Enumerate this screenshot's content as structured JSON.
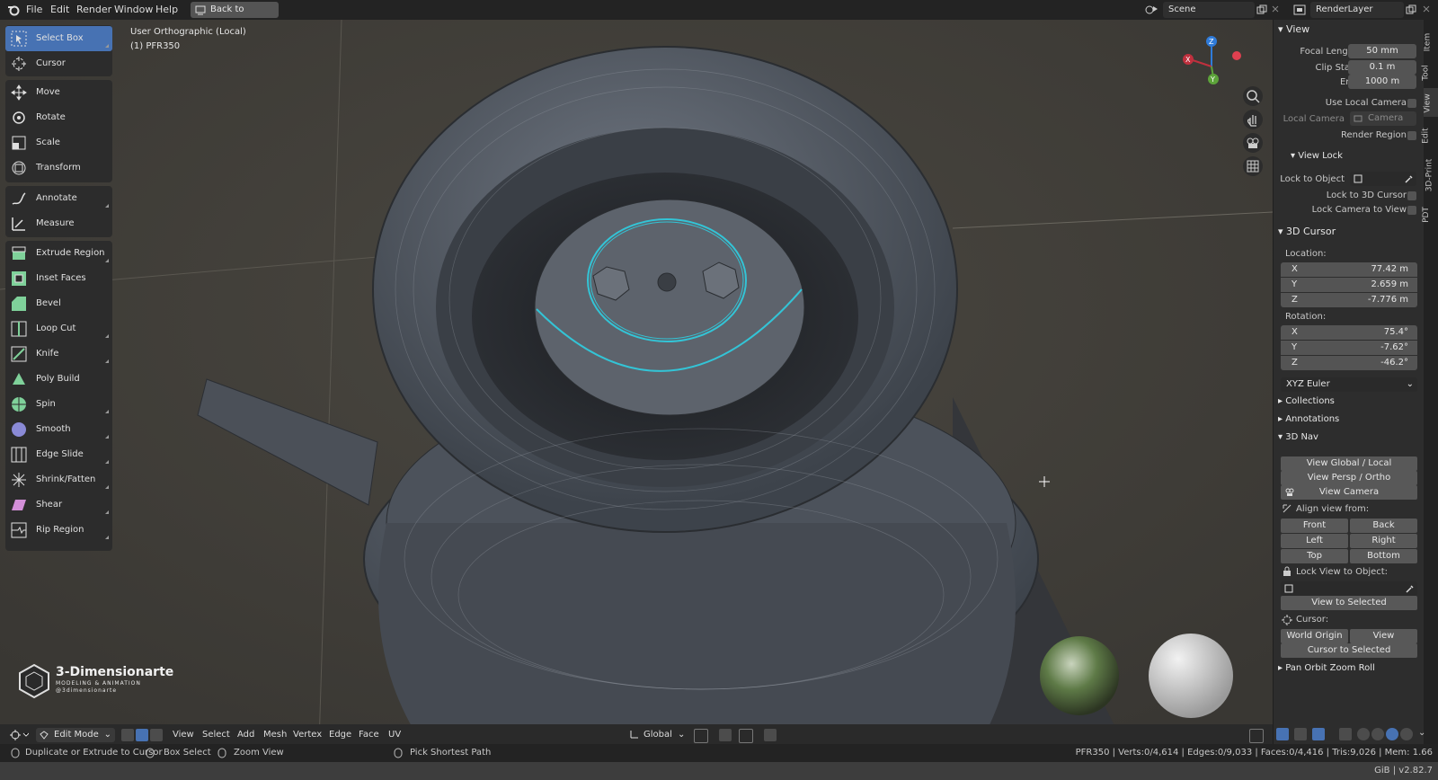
{
  "topbar": {
    "menus": [
      "File",
      "Edit",
      "Render",
      "Window",
      "Help"
    ],
    "back_label": "Back to Previous",
    "scene": "Scene",
    "render_layer": "RenderLayer"
  },
  "viewport": {
    "view_name": "User Orthographic (Local)",
    "object_name": "(1) PFR350",
    "logo_title": "3-Dimensionarte",
    "logo_sub": "MODELING & ANIMATION",
    "logo_sub2": "@3dimensionarte",
    "gizmo": {
      "x": "X",
      "y": "Y",
      "z": "Z"
    }
  },
  "tools": [
    "Select Box",
    "Cursor",
    "Move",
    "Rotate",
    "Scale",
    "Transform",
    "Annotate",
    "Measure",
    "Extrude Region",
    "Inset Faces",
    "Bevel",
    "Loop Cut",
    "Knife",
    "Poly Build",
    "Spin",
    "Smooth",
    "Edge Slide",
    "Shrink/Fatten",
    "Shear",
    "Rip Region"
  ],
  "sidebar": {
    "tabs": [
      "Item",
      "Tool",
      "View",
      "Edit",
      "3D-Print",
      "PDT"
    ],
    "view": {
      "title": "View",
      "focal_length_label": "Focal Length",
      "focal_length": "50 mm",
      "clip_start_label": "Clip Start",
      "clip_start": "0.1 m",
      "end_label": "End",
      "end": "1000 m",
      "use_local_camera": "Use Local Camera",
      "local_camera_label": "Local Camera",
      "local_camera": "Camera",
      "render_region": "Render Region"
    },
    "view_lock": {
      "title": "View Lock",
      "lock_to_object": "Lock to Object",
      "lock_to_cursor": "Lock to 3D Cursor",
      "lock_camera": "Lock Camera to View"
    },
    "cursor": {
      "title": "3D Cursor",
      "location_label": "Location:",
      "loc": [
        {
          "axis": "X",
          "value": "77.42 m"
        },
        {
          "axis": "Y",
          "value": "2.659 m"
        },
        {
          "axis": "Z",
          "value": "-7.776 m"
        }
      ],
      "rotation_label": "Rotation:",
      "rot": [
        {
          "axis": "X",
          "value": "75.4°"
        },
        {
          "axis": "Y",
          "value": "-7.62°"
        },
        {
          "axis": "Z",
          "value": "-46.2°"
        }
      ],
      "rotation_mode": "XYZ Euler"
    },
    "collections": "Collections",
    "annotations": "Annotations",
    "nav": {
      "title": "3D Nav",
      "view_global_local": "View Global / Local",
      "view_persp_ortho": "View Persp / Ortho",
      "view_camera": "View Camera",
      "align_label": "Align view from:",
      "front": "Front",
      "back": "Back",
      "left": "Left",
      "right": "Right",
      "top": "Top",
      "bottom": "Bottom",
      "lock_view_label": "Lock View to Object:",
      "view_to_selected": "View to Selected",
      "cursor_label": "Cursor:",
      "world_origin": "World Origin",
      "view": "View",
      "cursor_to_selected": "Cursor to Selected",
      "pan_orbit": "Pan Orbit Zoom Roll"
    }
  },
  "bottombar": {
    "mode": "Edit Mode",
    "menus": [
      "View",
      "Select",
      "Add",
      "Mesh",
      "Vertex",
      "Edge",
      "Face",
      "UV"
    ],
    "orientation": "Global"
  },
  "status": {
    "hint1": "Duplicate or Extrude to Cursor",
    "hint2": "Box Select",
    "hint3": "Zoom View",
    "hint4": "Pick Shortest Path",
    "stats": "PFR350 | Verts:0/4,614 | Edges:0/9,033 | Faces:0/4,416 | Tris:9,026 | Mem: 1.66 GiB | v2.82.7"
  },
  "colors": {
    "accent": "#4772b3",
    "selection": "#33c4d6",
    "header": "#232323",
    "panel": "#2d2d2d"
  }
}
